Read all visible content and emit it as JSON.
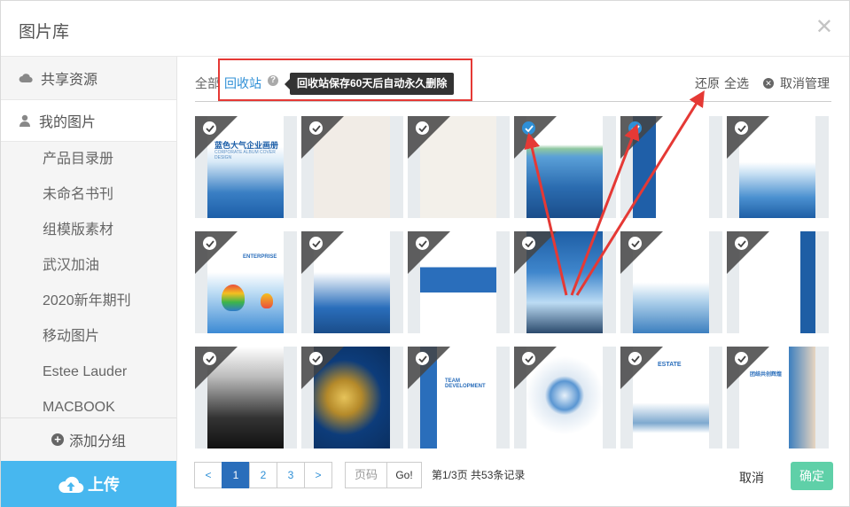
{
  "dialog": {
    "title": "图片库",
    "close_icon": "close-icon"
  },
  "sidebar": {
    "shared": "共享资源",
    "mine": "我的图片",
    "groups": [
      "产品目录册",
      "未命名书刊",
      "组模版素材",
      "武汉加油",
      "2020新年期刊",
      "移动图片",
      "Estee Lauder",
      "MACBOOK"
    ],
    "add_group": "添加分组",
    "upload": "上传"
  },
  "toolbar": {
    "all": "全部",
    "recycle": "回收站",
    "help": "?",
    "tooltip": "回收站保存60天后自动永久删除",
    "restore": "还原",
    "select_all": "全选",
    "cancel_manage": "取消管理"
  },
  "thumbnails": [
    {
      "checked": false
    },
    {
      "checked": false
    },
    {
      "checked": false
    },
    {
      "checked": true
    },
    {
      "checked": true
    },
    {
      "checked": false
    },
    {
      "checked": false
    },
    {
      "checked": false
    },
    {
      "checked": false
    },
    {
      "checked": false
    },
    {
      "checked": false
    },
    {
      "checked": false
    },
    {
      "checked": false
    },
    {
      "checked": false
    },
    {
      "checked": false
    },
    {
      "checked": false
    },
    {
      "checked": false
    },
    {
      "checked": false
    }
  ],
  "thumb_text": {
    "t1_title": "蓝色大气企业画册",
    "t1_sub": "CORPORATE ALBUM COVER DESIGN",
    "t7_text": "ENTERPRISE",
    "t15_text": "TEAM DEVELOPMENT",
    "t17_text": "ESTATE",
    "t18_text": "团结共创辉煌"
  },
  "pagination": {
    "prev": "<",
    "pages": [
      "1",
      "2",
      "3"
    ],
    "next": ">",
    "current": "1",
    "input_placeholder": "页码",
    "go": "Go!",
    "info": "第1/3页 共53条记录"
  },
  "footer": {
    "cancel": "取消",
    "ok": "确定"
  },
  "colors": {
    "accent": "#2e8fd6",
    "upload": "#47b7ef",
    "ok": "#5fd0a8",
    "annotation": "#e53935"
  }
}
